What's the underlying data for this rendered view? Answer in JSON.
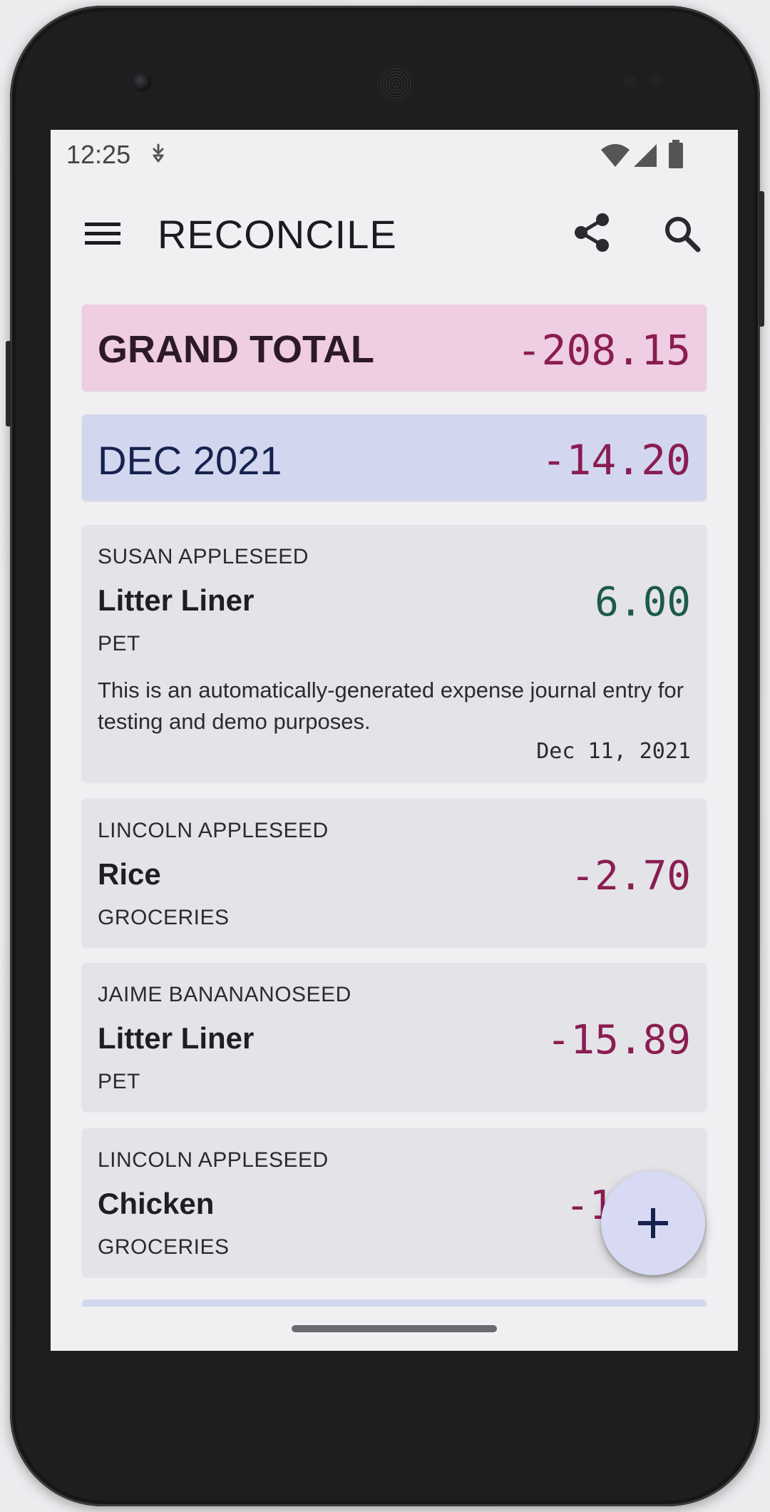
{
  "status_bar": {
    "time": "12:25",
    "icons": [
      "data-saver-icon",
      "wifi-icon",
      "cellular-signal-icon",
      "battery-icon"
    ]
  },
  "app_bar": {
    "title": "RECONCILE",
    "icons": [
      "menu-icon",
      "share-icon",
      "search-icon"
    ]
  },
  "summary": {
    "grand_total_label": "GRAND TOTAL",
    "grand_total_amount": "-208.15",
    "month_label": "DEC 2021",
    "month_amount": "-14.20"
  },
  "entries": [
    {
      "person": "SUSAN APPLESEED",
      "item": "Litter Liner",
      "category": "PET",
      "amount": "6.00",
      "note": "This is an automatically-generated expense journal entry for testing and demo purposes.",
      "date": "Dec 11, 2021"
    },
    {
      "person": "LINCOLN APPLESEED",
      "item": "Rice",
      "category": "GROCERIES",
      "amount": "-2.70"
    },
    {
      "person": "JAIME BANANANOSEED",
      "item": "Litter Liner",
      "category": "PET",
      "amount": "-15.89"
    },
    {
      "person": "LINCOLN APPLESEED",
      "item": "Chicken",
      "category": "GROCERIES",
      "amount": "-1"
    }
  ],
  "fab": {
    "icon": "plus-icon"
  },
  "colors": {
    "grand_total_bg": "#efcde3",
    "month_bg": "#d2d7ef",
    "positive_amount": "#1c5b4a",
    "negative_amount": "#8a1d52",
    "fab_bg": "#d7daf2"
  }
}
